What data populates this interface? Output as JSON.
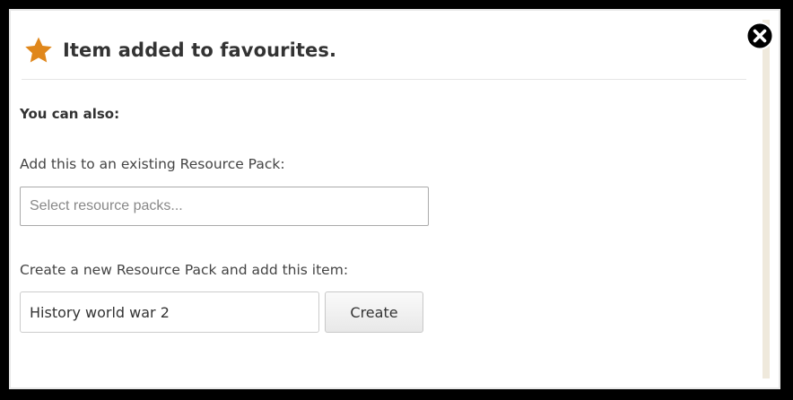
{
  "dialog": {
    "title": "Item added to favourites.",
    "also_heading": "You can also:",
    "existing_pack": {
      "label": "Add this to an existing Resource Pack:",
      "placeholder": "Select resource packs..."
    },
    "new_pack": {
      "label": "Create a new Resource Pack and add this item:",
      "input_value": "History world war 2",
      "create_label": "Create"
    }
  },
  "icons": {
    "star": "star-icon",
    "close": "close-icon"
  },
  "colors": {
    "star": "#e0871b",
    "close_bg": "#000000"
  }
}
